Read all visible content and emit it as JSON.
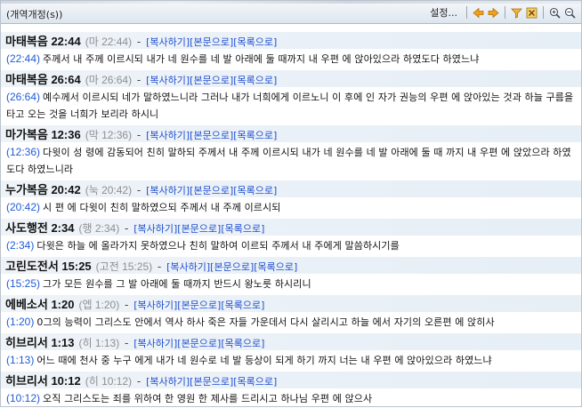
{
  "window": {
    "title": "(개역개정(s))"
  },
  "toolbar": {
    "settings_label": "설정...",
    "icons": [
      "arrow-left-icon",
      "arrow-right-icon",
      "filter-icon",
      "close-box-icon",
      "zoom-in-icon",
      "zoom-out-icon"
    ]
  },
  "links": {
    "copy": "복사하기",
    "text": "본문으로",
    "list": "목록으로"
  },
  "verses": [
    {
      "ref": "마태복음 22:44",
      "abbr": "(마 22:44)",
      "num": "(22:44)",
      "text": "주께서 내 주께 이르시되 내가 네 원수를 네 발 아래에 둘 때까지 내 우편 에 앉아있으라 하였도다 하였느냐"
    },
    {
      "ref": "마태복음 26:64",
      "abbr": "(마 26:64)",
      "num": "(26:64)",
      "text": "예수께서 이르시되 네가 말하였느니라 그러나 내가 너희에게 이르노니 이 후에 인 자가 권능의 우편 에 앉아있는 것과 하늘 구름을 타고 오는 것을 너희가 보리라 하시니"
    },
    {
      "ref": "마가복음 12:36",
      "abbr": "(막 12:36)",
      "num": "(12:36)",
      "text": "다윗이 성 령에 감동되어 친히 말하되 주께서 내 주께 이르시되 내가 네 원수를 네 발 아래에 둘 때 까지 내 우편 에 앉았으라 하였도다 하였느니라"
    },
    {
      "ref": "누가복음 20:42",
      "abbr": "(눅 20:42)",
      "num": "(20:42)",
      "text": "시 편 에 다윗이 친히 말하였으되 주께서 내 주께 이르시되"
    },
    {
      "ref": "사도행전 2:34",
      "abbr": "(행 2:34)",
      "num": "(2:34)",
      "text": "다윗은 하늘 에 올라가지 못하였으나 친히 말하여 이르되 주께서 내 주에게 말씀하시기를"
    },
    {
      "ref": "고린도전서 15:25",
      "abbr": "(고전 15:25)",
      "num": "(15:25)",
      "text": "그가 모든 원수를 그 발 아래에 둘 때까지 반드시 왕노릇 하시리니"
    },
    {
      "ref": "에베소서 1:20",
      "abbr": "(엡 1:20)",
      "num": "(1:20)",
      "text": "0그의 능력이 그리스도 안에서 역사 하사 죽은 자들 가운데서 다시 살리시고 하늘 에서 자기의 오른편 에 앉히사"
    },
    {
      "ref": "히브리서 1:13",
      "abbr": "(히 1:13)",
      "num": "(1:13)",
      "text": "어느 때에 천사 중 누구 에게 내가 네 원수로 네 발 등상이 되게 하기 까지 너는 내 우편 에 앉아있으라 하였느냐"
    },
    {
      "ref": "히브리서 10:12",
      "abbr": "(히 10:12)",
      "num": "(10:12)",
      "text": "오직 그리스도는 죄를 위하여 한 영원 한 제사를 드리시고 하나님 우편 에 앉으사"
    }
  ],
  "colors": {
    "link": "#1f4fd0",
    "verse_number": "#1f5bd8",
    "header_bg": "#eef3f8"
  }
}
